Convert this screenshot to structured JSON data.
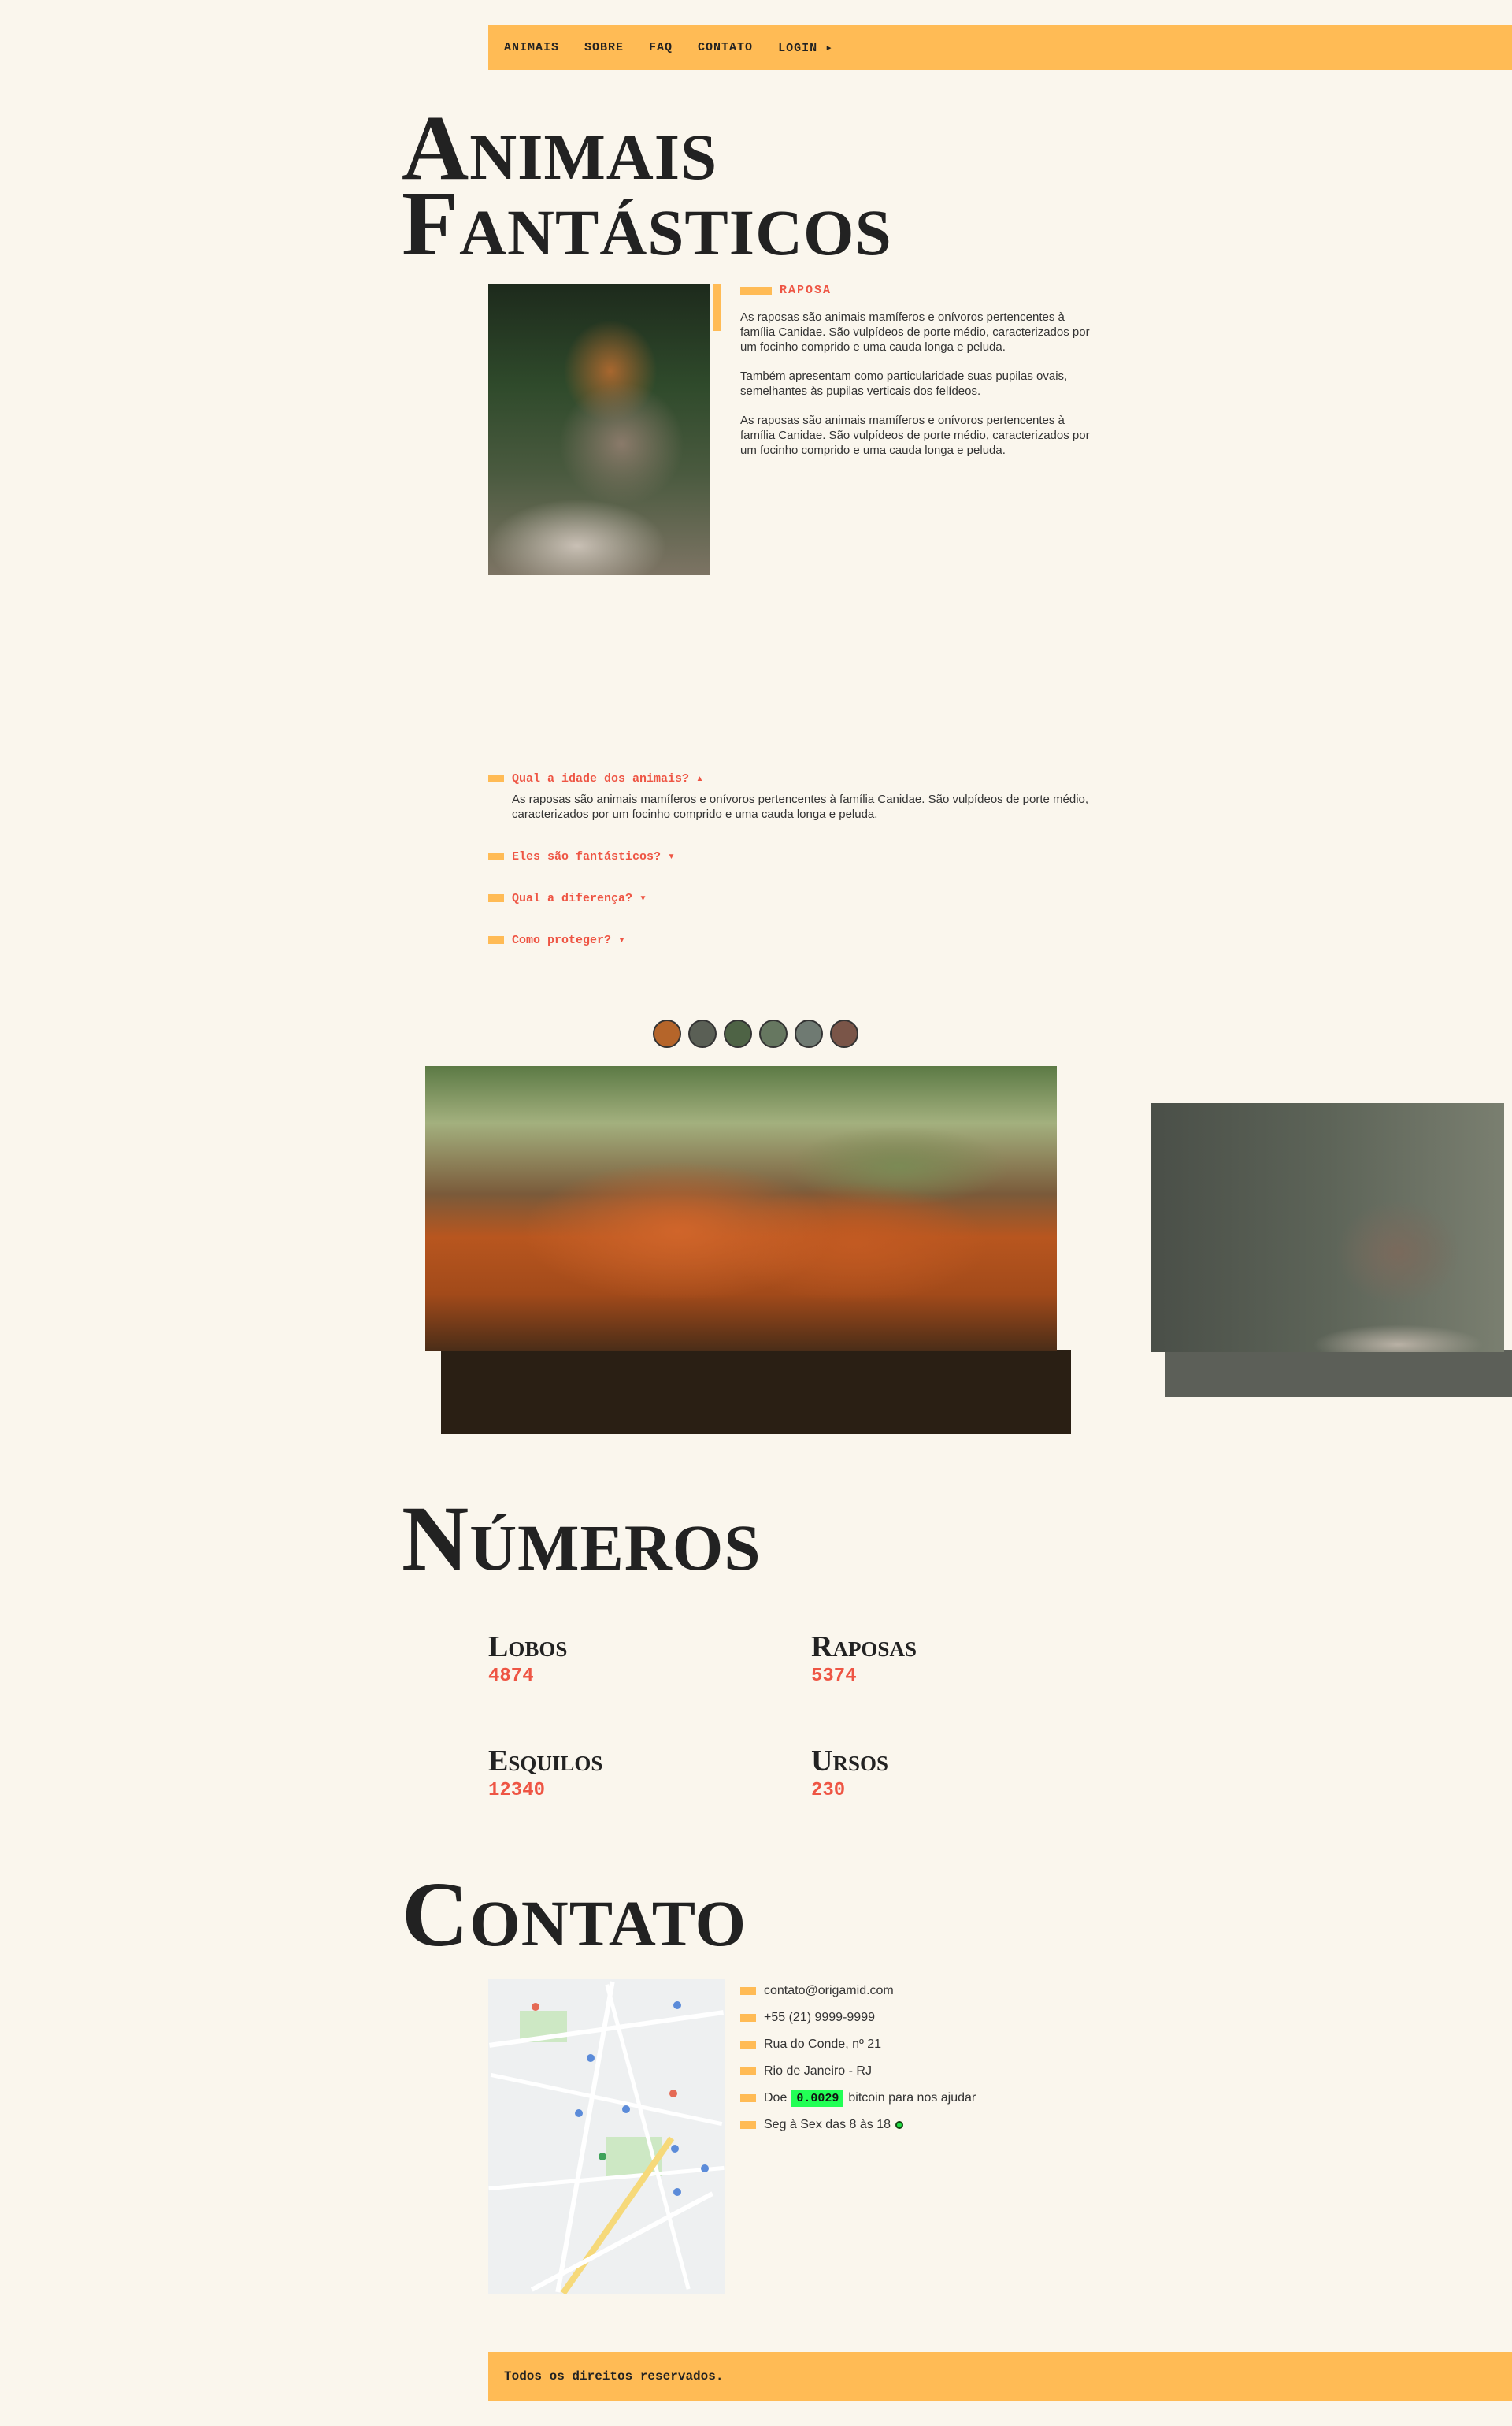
{
  "nav": {
    "items": [
      "ANIMAIS",
      "SOBRE",
      "FAQ",
      "CONTATO",
      "LOGIN ▸"
    ]
  },
  "hero": {
    "title_line1": "Animais",
    "title_line2": "Fantásticos"
  },
  "animal": {
    "name": "RAPOSA",
    "paragraphs": [
      "As raposas são animais mamíferos e onívoros pertencentes à família Canidae. São vulpídeos de porte médio, caracterizados por um focinho comprido e uma cauda longa e peluda.",
      "Também apresentam como particularidade suas pupilas ovais, semelhantes às pupilas verticais dos felídeos.",
      "As raposas são animais mamíferos e onívoros pertencentes à família Canidae. São vulpídeos de porte médio, caracterizados por um focinho comprido e uma cauda longa e peluda."
    ]
  },
  "faq": {
    "items": [
      {
        "question": "Qual a idade dos animais? ▴",
        "answer": "As raposas são animais mamíferos e onívoros pertencentes à família Canidae. São vulpídeos de porte médio, caracterizados por um focinho comprido e uma cauda longa e peluda."
      },
      {
        "question": "Eles são fantásticos? ▾",
        "answer": ""
      },
      {
        "question": "Qual a diferença? ▾",
        "answer": ""
      },
      {
        "question": "Como proteger? ▾",
        "answer": ""
      }
    ]
  },
  "gallery": {
    "thumb_colors": [
      "#B5652A",
      "#5A5F55",
      "#4E6345",
      "#667760",
      "#6F7A72",
      "#7A5548"
    ]
  },
  "numbers": {
    "title": "Números",
    "items": [
      {
        "label": "Lobos",
        "value": "4874"
      },
      {
        "label": "Raposas",
        "value": "5374"
      },
      {
        "label": "Esquilos",
        "value": "12340"
      },
      {
        "label": "Ursos",
        "value": "230"
      }
    ]
  },
  "contact": {
    "title": "Contato",
    "email": "contato@origamid.com",
    "phone": "+55 (21) 9999-9999",
    "address": "Rua do Conde, nº 21",
    "city": "Rio de Janeiro - RJ",
    "donate_prefix": "Doe",
    "donate_amount": "0.0029",
    "donate_suffix": "bitcoin para nos ajudar",
    "hours": "Seg à Sex das 8 às 18"
  },
  "footer": {
    "text": "Todos os direitos reservados."
  },
  "colors": {
    "accent": "#FFBB55",
    "highlight": "#EE5544",
    "background": "#FAF6ED",
    "bitcoin": "#22FF55"
  }
}
